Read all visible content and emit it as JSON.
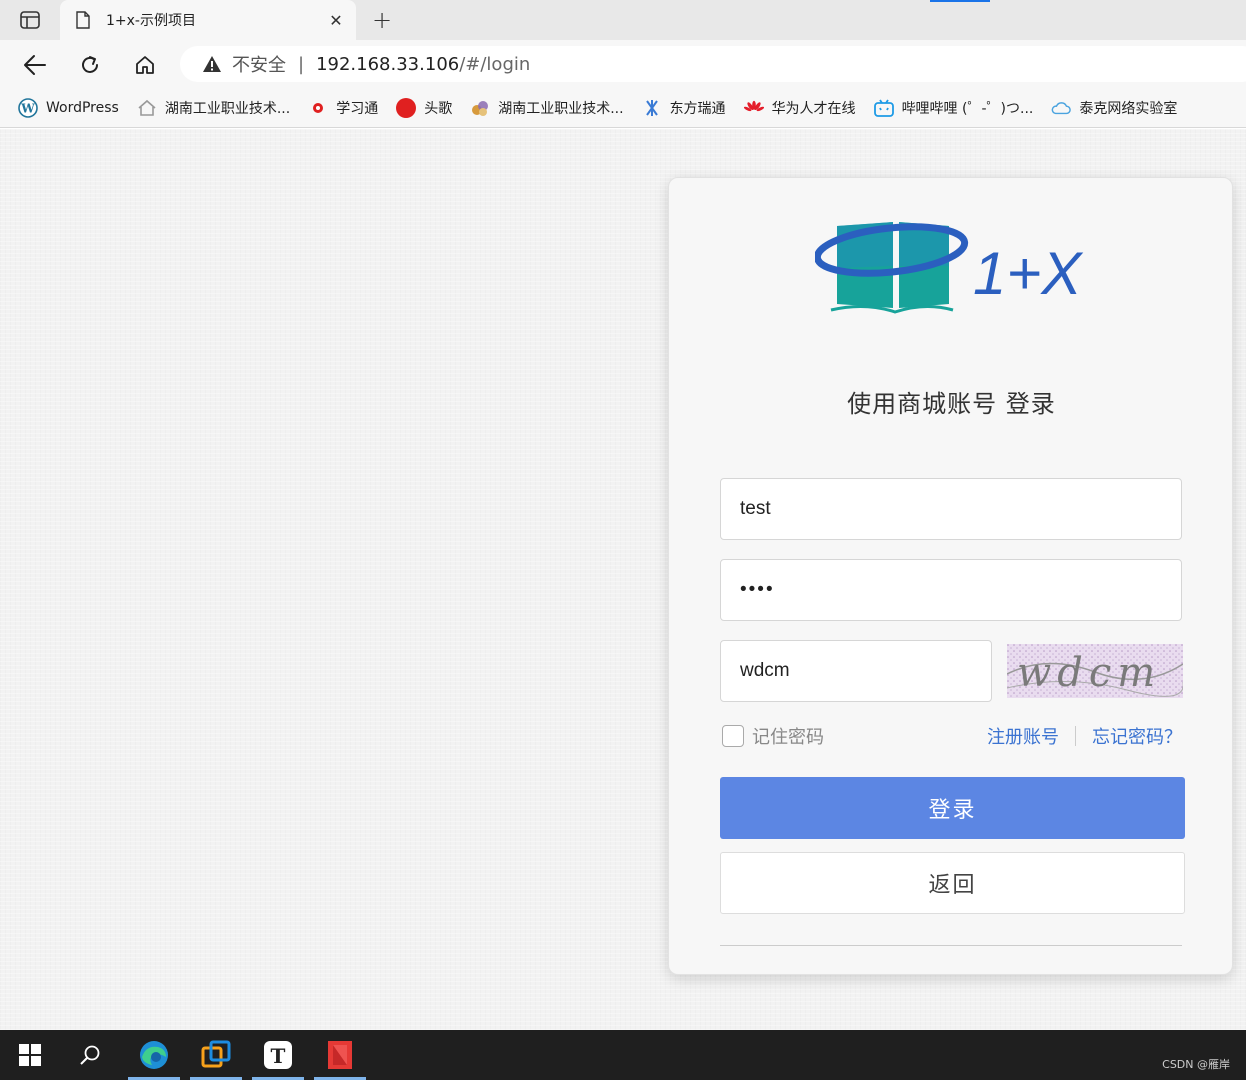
{
  "browser": {
    "tab_title": "1+x-示例项目",
    "tab_close": "✕",
    "new_tab": "+",
    "security_label": "不安全",
    "address_separator": "|",
    "url_host": "192.168.33.106",
    "url_path": "/#/login"
  },
  "bookmarks": [
    {
      "label": "WordPress",
      "icon": "wordpress-icon"
    },
    {
      "label": "湖南工业职业技术...",
      "icon": "home-outline-icon"
    },
    {
      "label": "学习通",
      "icon": "xuexitong-icon"
    },
    {
      "label": "头歌",
      "icon": "touge-icon"
    },
    {
      "label": "湖南工业职业技术...",
      "icon": "school-logo-icon"
    },
    {
      "label": "东方瑞通",
      "icon": "dongfang-icon"
    },
    {
      "label": "华为人才在线",
      "icon": "huawei-icon"
    },
    {
      "label": "哔哩哔哩 (゜-゜)つ...",
      "icon": "bilibili-icon"
    },
    {
      "label": "泰克网络实验室",
      "icon": "cloud-icon"
    }
  ],
  "login": {
    "title": "使用商城账号 登录",
    "username_value": "test",
    "password_value": "••••",
    "captcha_value": "wdcm",
    "captcha_text": "wdcm",
    "remember_label": "记住密码",
    "register_link": "注册账号",
    "forgot_link": "忘记密码？",
    "login_button": "登录",
    "back_button": "返回",
    "logo_text": "1+X"
  },
  "taskbar": {
    "watermark": "CSDN @雁岸"
  },
  "colors": {
    "accent": "#5c86e3",
    "link": "#3b73d1",
    "logo_blue": "#2b5fbf",
    "logo_teal": "#17a39a"
  }
}
